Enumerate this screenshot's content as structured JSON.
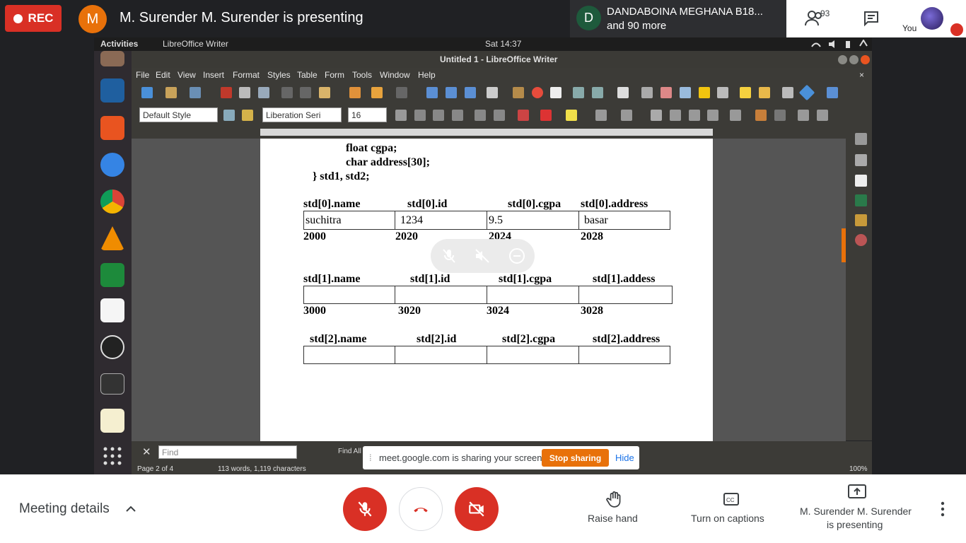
{
  "meet": {
    "rec_label": "REC",
    "presenter_initial": "M",
    "presenter_banner": "M. Surender M. Surender is presenting",
    "participant_initial": "D",
    "participant_name": "DANDABOINA MEGHANA B18...",
    "participant_more": "and 90 more",
    "people_count": "93",
    "you_label": "You",
    "share_notice": "meet.google.com is sharing your screen.",
    "stop_sharing": "Stop sharing",
    "hide": "Hide",
    "meeting_details": "Meeting details",
    "raise_hand": "Raise hand",
    "captions": "Turn on captions",
    "presenting_line1": "M. Surender M. Surender",
    "presenting_line2": "is presenting",
    "colors": {
      "rec": "#d93025",
      "presenter_avatar": "#e8710a",
      "participant_avatar": "#1e5a3c",
      "stop_sharing": "#e8710a",
      "end_call": "#d93025"
    }
  },
  "ubuntu": {
    "activities": "Activities",
    "app_menu": "LibreOffice Writer",
    "clock": "Sat 14:37"
  },
  "writer": {
    "window_title": "Untitled 1 - LibreOffice Writer",
    "menu": [
      "File",
      "Edit",
      "View",
      "Insert",
      "Format",
      "Styles",
      "Table",
      "Form",
      "Tools",
      "Window",
      "Help"
    ],
    "paragraph_style": "Default Style",
    "font_name": "Liberation Seri",
    "font_size": "16",
    "find_placeholder": "Find",
    "find_all": "Find All",
    "status_page": "Page 2 of 4",
    "status_words": "113 words, 1,119 characters",
    "zoom": "100%"
  },
  "document": {
    "code_lines": [
      "float cgpa;",
      "char address[30];",
      "} std1, std2;"
    ],
    "std0": {
      "headers": [
        "std[0].name",
        "std[0].id",
        "std[0].cgpa",
        "std[0].address"
      ],
      "values": [
        "suchitra",
        "1234",
        "9.5",
        "basar"
      ],
      "addresses": [
        "2000",
        "2020",
        "2024",
        "2028"
      ]
    },
    "std1": {
      "headers": [
        "std[1].name",
        "std[1].id",
        "std[1].cgpa",
        "std[1].addess"
      ],
      "addresses": [
        "3000",
        "3020",
        "3024",
        "3028"
      ]
    },
    "std2": {
      "headers": [
        "std[2].name",
        "std[2].id",
        "std[2].cgpa",
        "std[2].address"
      ]
    }
  }
}
